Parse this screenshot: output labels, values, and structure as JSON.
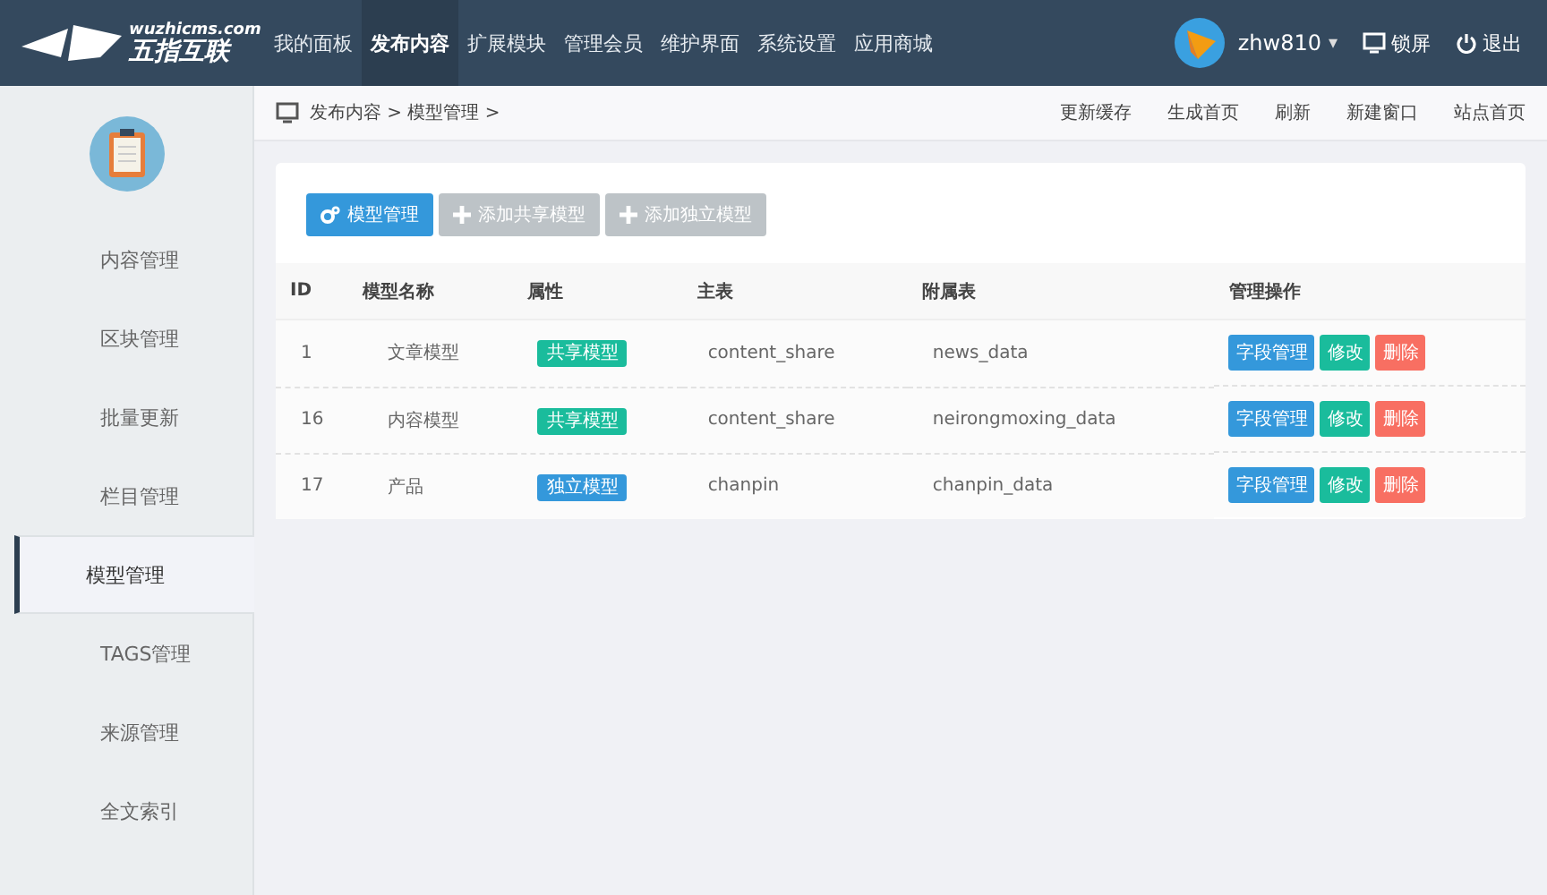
{
  "logo": {
    "domain": "wuzhicms.com",
    "name": "五指互联"
  },
  "nav": [
    {
      "label": "我的面板",
      "selected": false
    },
    {
      "label": "发布内容",
      "selected": true
    },
    {
      "label": "扩展模块",
      "selected": false
    },
    {
      "label": "管理会员",
      "selected": false
    },
    {
      "label": "维护界面",
      "selected": false
    },
    {
      "label": "系统设置",
      "selected": false
    },
    {
      "label": "应用商城",
      "selected": false
    }
  ],
  "user": {
    "name": "zhw810",
    "caret": "▾"
  },
  "header_actions": [
    "锁屏",
    "退出"
  ],
  "sidebar": {
    "items": [
      {
        "label": "内容管理",
        "selected": false
      },
      {
        "label": "区块管理",
        "selected": false
      },
      {
        "label": "批量更新",
        "selected": false
      },
      {
        "label": "栏目管理",
        "selected": false
      },
      {
        "label": "模型管理",
        "selected": true
      },
      {
        "label": "TAGS管理",
        "selected": false
      },
      {
        "label": "来源管理",
        "selected": false
      },
      {
        "label": "全文索引",
        "selected": false
      }
    ]
  },
  "breadcrumb": "发布内容 > 模型管理 >",
  "top_links": [
    "更新缓存",
    "生成首页",
    "刷新",
    "新建窗口",
    "站点首页"
  ],
  "toolbar": [
    {
      "label": "模型管理",
      "selected": true
    },
    {
      "label": "添加共享模型",
      "selected": false
    },
    {
      "label": "添加独立模型",
      "selected": false
    }
  ],
  "table": {
    "columns": [
      "ID",
      "模型名称",
      "属性",
      "主表",
      "附属表",
      "管理操作"
    ],
    "rows": [
      {
        "id": "1",
        "name": "文章模型",
        "attribute": {
          "label": "共享模型",
          "kind": "shared"
        },
        "main_table": "content_share",
        "sub_table": "news_data",
        "actions": [
          "字段管理",
          "修改",
          "删除"
        ]
      },
      {
        "id": "16",
        "name": "内容模型",
        "attribute": {
          "label": "共享模型",
          "kind": "shared"
        },
        "main_table": "content_share",
        "sub_table": "neirongmoxing_data",
        "actions": [
          "字段管理",
          "修改",
          "删除"
        ]
      },
      {
        "id": "17",
        "name": "产品",
        "attribute": {
          "label": "独立模型",
          "kind": "independent"
        },
        "main_table": "chanpin",
        "sub_table": "chanpin_data",
        "actions": [
          "字段管理",
          "修改",
          "删除"
        ]
      }
    ]
  }
}
